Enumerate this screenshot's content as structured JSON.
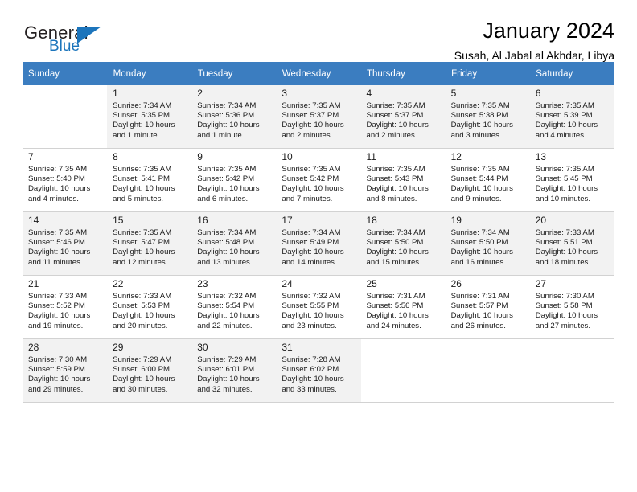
{
  "brand": {
    "name_part1": "General",
    "name_part2": "Blue",
    "flag_icon": "blue-triangle-flag-icon",
    "accent_color": "#1c75bc"
  },
  "header": {
    "title": "January 2024",
    "location": "Susah, Al Jabal al Akhdar, Libya"
  },
  "theme": {
    "header_row_bg": "#3b7dc0",
    "shaded_row_bg": "#f2f2f2",
    "grid_line": "#d2d2d2"
  },
  "calendar": {
    "weekday_headers": [
      "Sunday",
      "Monday",
      "Tuesday",
      "Wednesday",
      "Thursday",
      "Friday",
      "Saturday"
    ],
    "labels": {
      "sunrise_prefix": "Sunrise:",
      "sunset_prefix": "Sunset:",
      "daylight_prefix": "Daylight:"
    },
    "weeks": [
      [
        {
          "day": "",
          "sunrise": "",
          "sunset": "",
          "daylight_line1": "",
          "daylight_line2": ""
        },
        {
          "day": "1",
          "sunrise": "Sunrise: 7:34 AM",
          "sunset": "Sunset: 5:35 PM",
          "daylight_line1": "Daylight: 10 hours",
          "daylight_line2": "and 1 minute."
        },
        {
          "day": "2",
          "sunrise": "Sunrise: 7:34 AM",
          "sunset": "Sunset: 5:36 PM",
          "daylight_line1": "Daylight: 10 hours",
          "daylight_line2": "and 1 minute."
        },
        {
          "day": "3",
          "sunrise": "Sunrise: 7:35 AM",
          "sunset": "Sunset: 5:37 PM",
          "daylight_line1": "Daylight: 10 hours",
          "daylight_line2": "and 2 minutes."
        },
        {
          "day": "4",
          "sunrise": "Sunrise: 7:35 AM",
          "sunset": "Sunset: 5:37 PM",
          "daylight_line1": "Daylight: 10 hours",
          "daylight_line2": "and 2 minutes."
        },
        {
          "day": "5",
          "sunrise": "Sunrise: 7:35 AM",
          "sunset": "Sunset: 5:38 PM",
          "daylight_line1": "Daylight: 10 hours",
          "daylight_line2": "and 3 minutes."
        },
        {
          "day": "6",
          "sunrise": "Sunrise: 7:35 AM",
          "sunset": "Sunset: 5:39 PM",
          "daylight_line1": "Daylight: 10 hours",
          "daylight_line2": "and 4 minutes."
        }
      ],
      [
        {
          "day": "7",
          "sunrise": "Sunrise: 7:35 AM",
          "sunset": "Sunset: 5:40 PM",
          "daylight_line1": "Daylight: 10 hours",
          "daylight_line2": "and 4 minutes."
        },
        {
          "day": "8",
          "sunrise": "Sunrise: 7:35 AM",
          "sunset": "Sunset: 5:41 PM",
          "daylight_line1": "Daylight: 10 hours",
          "daylight_line2": "and 5 minutes."
        },
        {
          "day": "9",
          "sunrise": "Sunrise: 7:35 AM",
          "sunset": "Sunset: 5:42 PM",
          "daylight_line1": "Daylight: 10 hours",
          "daylight_line2": "and 6 minutes."
        },
        {
          "day": "10",
          "sunrise": "Sunrise: 7:35 AM",
          "sunset": "Sunset: 5:42 PM",
          "daylight_line1": "Daylight: 10 hours",
          "daylight_line2": "and 7 minutes."
        },
        {
          "day": "11",
          "sunrise": "Sunrise: 7:35 AM",
          "sunset": "Sunset: 5:43 PM",
          "daylight_line1": "Daylight: 10 hours",
          "daylight_line2": "and 8 minutes."
        },
        {
          "day": "12",
          "sunrise": "Sunrise: 7:35 AM",
          "sunset": "Sunset: 5:44 PM",
          "daylight_line1": "Daylight: 10 hours",
          "daylight_line2": "and 9 minutes."
        },
        {
          "day": "13",
          "sunrise": "Sunrise: 7:35 AM",
          "sunset": "Sunset: 5:45 PM",
          "daylight_line1": "Daylight: 10 hours",
          "daylight_line2": "and 10 minutes."
        }
      ],
      [
        {
          "day": "14",
          "sunrise": "Sunrise: 7:35 AM",
          "sunset": "Sunset: 5:46 PM",
          "daylight_line1": "Daylight: 10 hours",
          "daylight_line2": "and 11 minutes."
        },
        {
          "day": "15",
          "sunrise": "Sunrise: 7:35 AM",
          "sunset": "Sunset: 5:47 PM",
          "daylight_line1": "Daylight: 10 hours",
          "daylight_line2": "and 12 minutes."
        },
        {
          "day": "16",
          "sunrise": "Sunrise: 7:34 AM",
          "sunset": "Sunset: 5:48 PM",
          "daylight_line1": "Daylight: 10 hours",
          "daylight_line2": "and 13 minutes."
        },
        {
          "day": "17",
          "sunrise": "Sunrise: 7:34 AM",
          "sunset": "Sunset: 5:49 PM",
          "daylight_line1": "Daylight: 10 hours",
          "daylight_line2": "and 14 minutes."
        },
        {
          "day": "18",
          "sunrise": "Sunrise: 7:34 AM",
          "sunset": "Sunset: 5:50 PM",
          "daylight_line1": "Daylight: 10 hours",
          "daylight_line2": "and 15 minutes."
        },
        {
          "day": "19",
          "sunrise": "Sunrise: 7:34 AM",
          "sunset": "Sunset: 5:50 PM",
          "daylight_line1": "Daylight: 10 hours",
          "daylight_line2": "and 16 minutes."
        },
        {
          "day": "20",
          "sunrise": "Sunrise: 7:33 AM",
          "sunset": "Sunset: 5:51 PM",
          "daylight_line1": "Daylight: 10 hours",
          "daylight_line2": "and 18 minutes."
        }
      ],
      [
        {
          "day": "21",
          "sunrise": "Sunrise: 7:33 AM",
          "sunset": "Sunset: 5:52 PM",
          "daylight_line1": "Daylight: 10 hours",
          "daylight_line2": "and 19 minutes."
        },
        {
          "day": "22",
          "sunrise": "Sunrise: 7:33 AM",
          "sunset": "Sunset: 5:53 PM",
          "daylight_line1": "Daylight: 10 hours",
          "daylight_line2": "and 20 minutes."
        },
        {
          "day": "23",
          "sunrise": "Sunrise: 7:32 AM",
          "sunset": "Sunset: 5:54 PM",
          "daylight_line1": "Daylight: 10 hours",
          "daylight_line2": "and 22 minutes."
        },
        {
          "day": "24",
          "sunrise": "Sunrise: 7:32 AM",
          "sunset": "Sunset: 5:55 PM",
          "daylight_line1": "Daylight: 10 hours",
          "daylight_line2": "and 23 minutes."
        },
        {
          "day": "25",
          "sunrise": "Sunrise: 7:31 AM",
          "sunset": "Sunset: 5:56 PM",
          "daylight_line1": "Daylight: 10 hours",
          "daylight_line2": "and 24 minutes."
        },
        {
          "day": "26",
          "sunrise": "Sunrise: 7:31 AM",
          "sunset": "Sunset: 5:57 PM",
          "daylight_line1": "Daylight: 10 hours",
          "daylight_line2": "and 26 minutes."
        },
        {
          "day": "27",
          "sunrise": "Sunrise: 7:30 AM",
          "sunset": "Sunset: 5:58 PM",
          "daylight_line1": "Daylight: 10 hours",
          "daylight_line2": "and 27 minutes."
        }
      ],
      [
        {
          "day": "28",
          "sunrise": "Sunrise: 7:30 AM",
          "sunset": "Sunset: 5:59 PM",
          "daylight_line1": "Daylight: 10 hours",
          "daylight_line2": "and 29 minutes."
        },
        {
          "day": "29",
          "sunrise": "Sunrise: 7:29 AM",
          "sunset": "Sunset: 6:00 PM",
          "daylight_line1": "Daylight: 10 hours",
          "daylight_line2": "and 30 minutes."
        },
        {
          "day": "30",
          "sunrise": "Sunrise: 7:29 AM",
          "sunset": "Sunset: 6:01 PM",
          "daylight_line1": "Daylight: 10 hours",
          "daylight_line2": "and 32 minutes."
        },
        {
          "day": "31",
          "sunrise": "Sunrise: 7:28 AM",
          "sunset": "Sunset: 6:02 PM",
          "daylight_line1": "Daylight: 10 hours",
          "daylight_line2": "and 33 minutes."
        },
        {
          "day": "",
          "sunrise": "",
          "sunset": "",
          "daylight_line1": "",
          "daylight_line2": ""
        },
        {
          "day": "",
          "sunrise": "",
          "sunset": "",
          "daylight_line1": "",
          "daylight_line2": ""
        },
        {
          "day": "",
          "sunrise": "",
          "sunset": "",
          "daylight_line1": "",
          "daylight_line2": ""
        }
      ]
    ]
  }
}
